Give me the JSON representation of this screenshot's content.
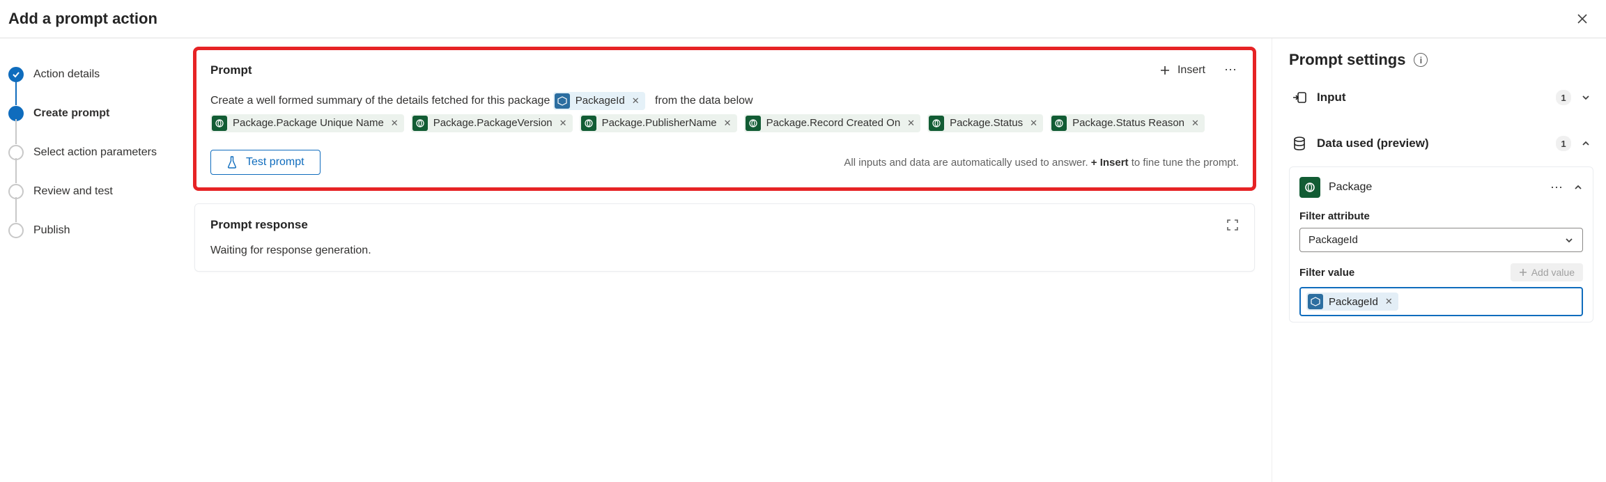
{
  "title": "Add a prompt action",
  "steps": [
    {
      "label": "Action details",
      "state": "done"
    },
    {
      "label": "Create prompt",
      "state": "active"
    },
    {
      "label": "Select action parameters",
      "state": "todo"
    },
    {
      "label": "Review and test",
      "state": "todo"
    },
    {
      "label": "Publish",
      "state": "todo"
    }
  ],
  "prompt_card": {
    "title": "Prompt",
    "insert_label": "Insert",
    "text_before": "Create a well formed summary of the details fetched for this package",
    "var_chip": "PackageId",
    "text_after": "from the data below",
    "chips": [
      "Package.Package Unique Name",
      "Package.PackageVersion",
      "Package.PublisherName",
      "Package.Record Created On",
      "Package.Status",
      "Package.Status Reason"
    ],
    "test_label": "Test prompt",
    "hint_pre": "All inputs and data are automatically used to answer. ",
    "hint_bold": "+ Insert",
    "hint_post": " to fine tune the prompt."
  },
  "response_card": {
    "title": "Prompt response",
    "body": "Waiting for response generation."
  },
  "settings": {
    "title": "Prompt settings",
    "input": {
      "label": "Input",
      "count": "1"
    },
    "data_used": {
      "label": "Data used (preview)",
      "count": "1"
    },
    "package": {
      "title": "Package",
      "filter_attr_label": "Filter attribute",
      "filter_attr_value": "PackageId",
      "filter_value_label": "Filter value",
      "add_value_label": "Add value",
      "filter_value_chip": "PackageId"
    }
  }
}
